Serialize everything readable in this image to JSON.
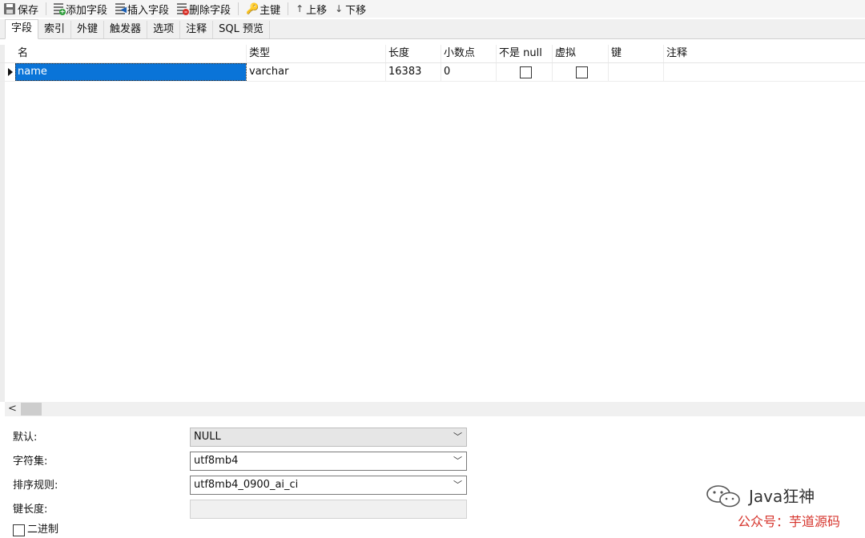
{
  "toolbar": {
    "save": "保存",
    "add_field": "添加字段",
    "insert_field": "插入字段",
    "delete_field": "删除字段",
    "primary_key": "主键",
    "move_up": "上移",
    "move_down": "下移"
  },
  "tabs": [
    "字段",
    "索引",
    "外键",
    "触发器",
    "选项",
    "注释",
    "SQL 预览"
  ],
  "grid": {
    "columns": [
      "名",
      "类型",
      "长度",
      "小数点",
      "不是 null",
      "虚拟",
      "键",
      "注释"
    ],
    "rows": [
      {
        "name": "name",
        "type": "varchar",
        "length": "16383",
        "decimals": "0",
        "not_null": false,
        "virtual": false,
        "key": "",
        "comment": ""
      }
    ]
  },
  "props": {
    "default_label": "默认:",
    "default_value": "NULL",
    "charset_label": "字符集:",
    "charset_value": "utf8mb4",
    "collation_label": "排序规则:",
    "collation_value": "utf8mb4_0900_ai_ci",
    "key_length_label": "键长度:",
    "key_length_value": "",
    "binary_label": "二进制"
  },
  "watermark": {
    "title": "Java狂神",
    "subtitle": "公众号：芋道源码"
  }
}
